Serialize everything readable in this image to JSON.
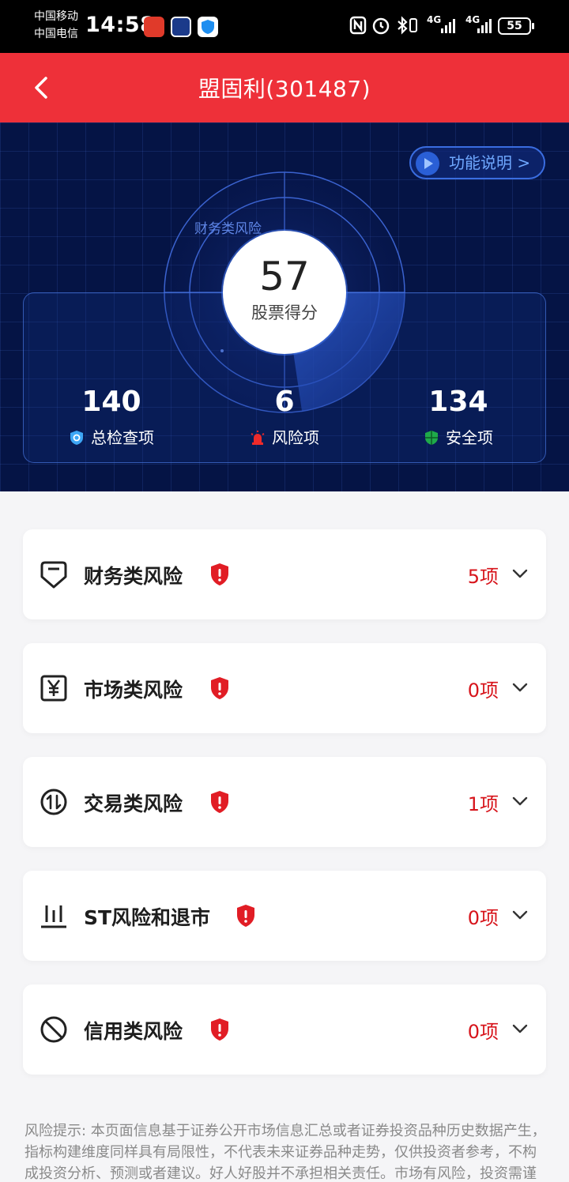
{
  "status_bar": {
    "carrier1": "中国移动",
    "carrier2": "中国电信",
    "time": "14:58",
    "battery": "55",
    "network1": "4G",
    "network2": "4G"
  },
  "header": {
    "title": "盟固利(301487)"
  },
  "hero": {
    "func_button": "功能说明 >",
    "score": "57",
    "score_label": "股票得分",
    "radar_label": "财务类风险",
    "stats": [
      {
        "value": "140",
        "label": "总检查项"
      },
      {
        "value": "6",
        "label": "风险项"
      },
      {
        "value": "134",
        "label": "安全项"
      }
    ]
  },
  "risk_categories": [
    {
      "name": "财务类风险",
      "count": "5项",
      "icon": "shield-outline-icon"
    },
    {
      "name": "市场类风险",
      "count": "0项",
      "icon": "yen-box-icon"
    },
    {
      "name": "交易类风险",
      "count": "1项",
      "icon": "exchange-arrows-icon"
    },
    {
      "name": "ST风险和退市",
      "count": "0项",
      "icon": "bars-chart-icon"
    },
    {
      "name": "信用类风险",
      "count": "0项",
      "icon": "prohibited-icon"
    }
  ],
  "disclaimer": "风险提示: 本页面信息基于证券公开市场信息汇总或者证券投资品种历史数据产生，指标构建维度同样具有局限性，不代表未来证券品种走势，仅供投资者参考，不构成投资分析、预测或者建议。好人好股并不承担相关责任。市场有风险，投资需谨慎。",
  "colors": {
    "brand_red": "#ee3039",
    "risk_red": "#d7141b",
    "hero_bg": "#051445"
  }
}
